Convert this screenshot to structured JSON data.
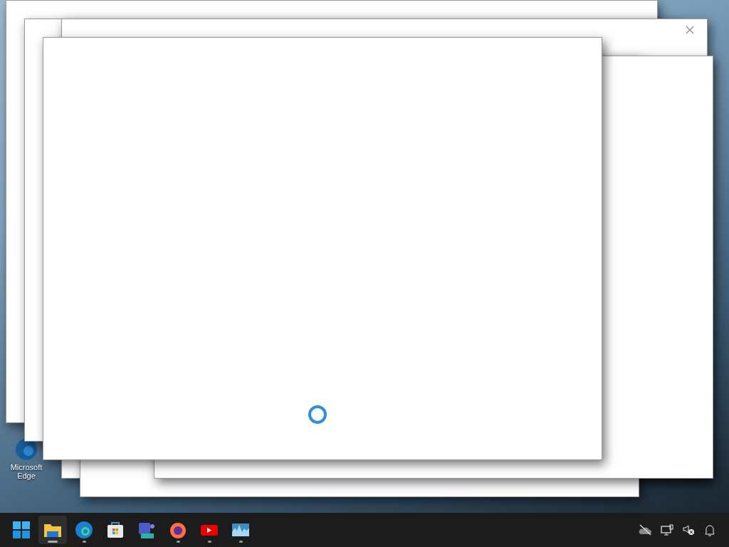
{
  "desktop_icons": [
    {
      "label": "Microsoft Edge"
    }
  ],
  "windows": [
    {
      "kind": "blank"
    },
    {
      "kind": "blank"
    },
    {
      "kind": "closable"
    },
    {
      "kind": "blank"
    },
    {
      "kind": "blank"
    },
    {
      "kind": "loading"
    }
  ],
  "taskbar": {
    "apps": [
      {
        "kind": "start",
        "running": false,
        "active": false
      },
      {
        "kind": "folder",
        "running": true,
        "active": true
      },
      {
        "kind": "edge",
        "running": true,
        "active": false
      },
      {
        "kind": "store",
        "running": false,
        "active": false
      },
      {
        "kind": "teams",
        "running": false,
        "active": false
      },
      {
        "kind": "firefox",
        "running": true,
        "active": false
      },
      {
        "kind": "youtube",
        "running": true,
        "active": false
      },
      {
        "kind": "monitor",
        "running": true,
        "active": false
      }
    ]
  }
}
